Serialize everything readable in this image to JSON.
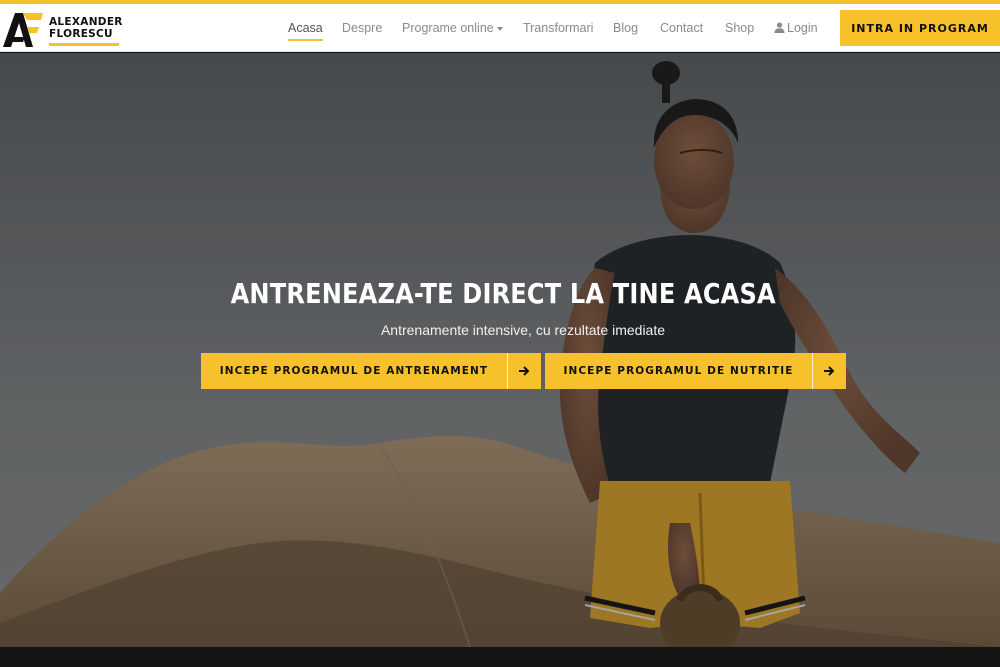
{
  "brand": {
    "line1": "ALEXANDER",
    "line2": "FLORESCU",
    "accent": "#f6c12a"
  },
  "nav": {
    "items": [
      {
        "label": "Acasa",
        "active": true
      },
      {
        "label": "Despre"
      },
      {
        "label": "Programe online",
        "dropdown": true
      },
      {
        "label": "Transformari"
      },
      {
        "label": "Blog"
      },
      {
        "label": "Contact"
      },
      {
        "label": "Shop"
      },
      {
        "label": "Login",
        "icon": "user-icon"
      }
    ],
    "cta": "INTRA IN PROGRAM"
  },
  "hero": {
    "title": "ANTRENEAZA-TE DIRECT LA TINE ACASA",
    "subtitle": "Antrenamente intensive, cu rezultate imediate",
    "buttons": [
      {
        "label": "INCEPE PROGRAMUL DE ANTRENAMENT",
        "icon": "arrow-right-icon"
      },
      {
        "label": "INCEPE PROGRAMUL DE NUTRITIE",
        "icon": "arrow-right-icon"
      }
    ]
  }
}
